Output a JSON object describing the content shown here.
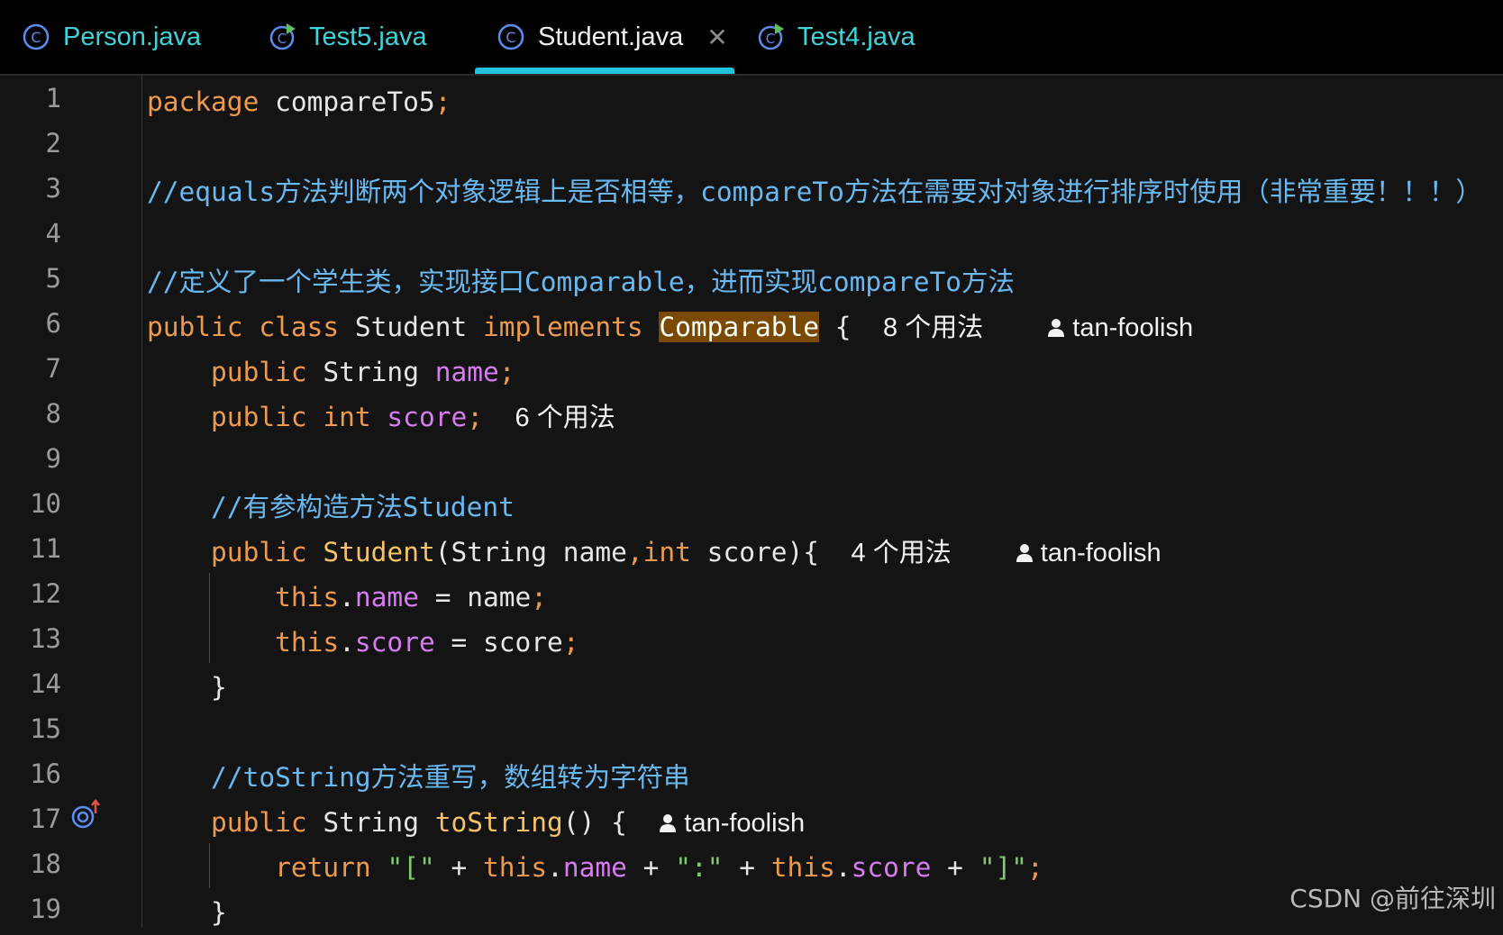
{
  "tabs": [
    {
      "label": "Person.java",
      "icon": "class-icon",
      "active": false
    },
    {
      "label": "Test5.java",
      "icon": "runnable-class-icon",
      "active": false
    },
    {
      "label": "Student.java",
      "icon": "class-icon",
      "active": true,
      "close": "✕"
    },
    {
      "label": "Test4.java",
      "icon": "runnable-class-icon",
      "active": false
    }
  ],
  "line_numbers": [
    "1",
    "2",
    "3",
    "4",
    "5",
    "6",
    "7",
    "8",
    "9",
    "10",
    "11",
    "12",
    "13",
    "14",
    "15",
    "16",
    "17",
    "18",
    "19"
  ],
  "code": {
    "l1": {
      "kw": "package",
      "rest": " compareTo5",
      "semi": ";"
    },
    "l3": {
      "comment": "//equals方法判断两个对象逻辑上是否相等，compareTo方法在需要对对象进行排序时使用（非常重要！！！）"
    },
    "l5": {
      "comment": "//定义了一个学生类，实现接口Comparable，进而实现compareTo方法"
    },
    "l6": {
      "kw1": "public class",
      "name": " Student ",
      "kw2": "implements",
      "iface": "Comparable",
      "brace": " {",
      "usages": "8 个用法",
      "author": "tan-foolish"
    },
    "l7": {
      "kw": "public",
      "type": " String ",
      "field": "name",
      "semi": ";"
    },
    "l8": {
      "kw": "public int",
      "field": " score",
      "semi": ";",
      "usages": "6 个用法"
    },
    "l10": {
      "comment": "//有参构造方法Student"
    },
    "l11": {
      "kw": "public",
      "ctor": "Student",
      "params1": "(String name",
      "comma": ",",
      "kw2": "int",
      "params2": " score){",
      "usages": "4 个用法",
      "author": "tan-foolish"
    },
    "l12": {
      "this": "this",
      "dot": ".",
      "field": "name",
      "assign": " = name",
      "semi": ";"
    },
    "l13": {
      "this": "this",
      "dot": ".",
      "field": "score",
      "assign": " = score",
      "semi": ";"
    },
    "l14": {
      "brace": "}"
    },
    "l16": {
      "comment": "//toString方法重写，数组转为字符串"
    },
    "l17": {
      "kw": "public",
      "type": " String ",
      "method": "toString",
      "rest": "() {",
      "author": "tan-foolish"
    },
    "l18": {
      "kw": "return",
      "s1": "\"[\"",
      "plus1": " + ",
      "this1": "this",
      "dot1": ".",
      "f1": "name",
      "plus2": " + ",
      "s2": "\":\"",
      "plus3": " + ",
      "this2": "this",
      "dot2": ".",
      "f2": "score",
      "plus4": " + ",
      "s3": "\"]\"",
      "semi": ";"
    },
    "l19": {
      "brace": "}"
    }
  },
  "watermark": "CSDN @前往深圳",
  "colors": {
    "keyword": "#ec9a4d",
    "field": "#d77cf0",
    "comment": "#6ab8f0",
    "method": "#f6c266",
    "string": "#7fc96e",
    "tab_accent": "#21c4dc"
  }
}
